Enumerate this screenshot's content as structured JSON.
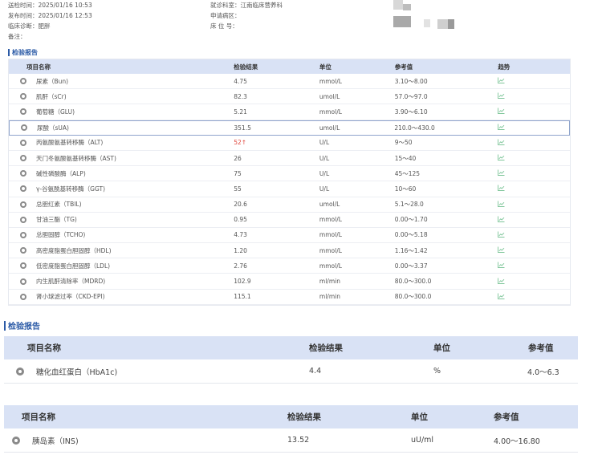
{
  "header": {
    "left": [
      {
        "label": "送检时间：",
        "value": "2025/01/16 10:53"
      },
      {
        "label": "发布时间：",
        "value": "2025/01/16 12:53"
      },
      {
        "label": "临床诊断：",
        "value": "肥胖"
      },
      {
        "label": "备注：",
        "value": ""
      }
    ],
    "right": [
      {
        "label": "就诊科室：",
        "value": "江南临床营养科"
      },
      {
        "label": "申请病区：",
        "value": ""
      },
      {
        "label": "床 位 号：",
        "value": ""
      }
    ]
  },
  "section1": {
    "title": "检验报告",
    "headers": {
      "name": "项目名称",
      "result": "检验结果",
      "unit": "单位",
      "ref": "参考值",
      "trend": "趋势"
    },
    "rows": [
      {
        "name": "尿素（Bun)",
        "result": "4.75",
        "unit": "mmol/L",
        "ref": "3.10～8.00"
      },
      {
        "name": "肌酐（sCr)",
        "result": "82.3",
        "unit": "umol/L",
        "ref": "57.0～97.0"
      },
      {
        "name": "葡萄糖（GLU)",
        "result": "5.21",
        "unit": "mmol/L",
        "ref": "3.90～6.10"
      },
      {
        "name": "尿酸（sUA)",
        "result": "351.5",
        "unit": "umol/L",
        "ref": "210.0～430.0"
      },
      {
        "name": "丙氨酸氨基转移酶（ALT)",
        "result": "52↑",
        "unit": "U/L",
        "ref": "9～50"
      },
      {
        "name": "天门冬氨酸氨基转移酶（AST)",
        "result": "26",
        "unit": "U/L",
        "ref": "15～40"
      },
      {
        "name": "碱性磷酸酶（ALP)",
        "result": "75",
        "unit": "U/L",
        "ref": "45～125"
      },
      {
        "name": "γ-谷氨酰基转移酶（GGT)",
        "result": "55",
        "unit": "U/L",
        "ref": "10～60"
      },
      {
        "name": "总胆红素（TBIL)",
        "result": "20.6",
        "unit": "umol/L",
        "ref": "5.1～28.0"
      },
      {
        "name": "甘油三酯（TG)",
        "result": "0.95",
        "unit": "mmol/L",
        "ref": "0.00～1.70"
      },
      {
        "name": "总胆固醇（TCHO)",
        "result": "4.73",
        "unit": "mmol/L",
        "ref": "0.00～5.18"
      },
      {
        "name": "高密度脂蛋白胆固醇（HDL)",
        "result": "1.20",
        "unit": "mmol/L",
        "ref": "1.16～1.42"
      },
      {
        "name": "低密度脂蛋白胆固醇（LDL)",
        "result": "2.76",
        "unit": "mmol/L",
        "ref": "0.00～3.37"
      },
      {
        "name": "内生肌酐清除率（MDRD)",
        "result": "102.9",
        "unit": "ml/min",
        "ref": "80.0～300.0"
      },
      {
        "name": "肾小球滤过率（CKD-EPI)",
        "result": "115.1",
        "unit": "ml/min",
        "ref": "80.0～300.0"
      }
    ]
  },
  "section2": {
    "title": "检验报告",
    "headers": {
      "name": "项目名称",
      "result": "检验结果",
      "unit": "单位",
      "ref": "参考值"
    },
    "rows": [
      {
        "name": "糖化血红蛋白（HbA1c)",
        "result": "4.4",
        "unit": "%",
        "ref": "4.0～6.3"
      }
    ]
  },
  "section3": {
    "headers": {
      "name": "项目名称",
      "result": "检验结果",
      "unit": "单位",
      "ref": "参考值"
    },
    "rows": [
      {
        "name": "胰岛素（INS)",
        "result": "13.52",
        "unit": "uU/ml",
        "ref": "4.00～16.80"
      }
    ]
  },
  "colors": {
    "accent": "#2b5aa6",
    "header_bg": "#d9e2f5",
    "abnormal": "#e0463c"
  }
}
